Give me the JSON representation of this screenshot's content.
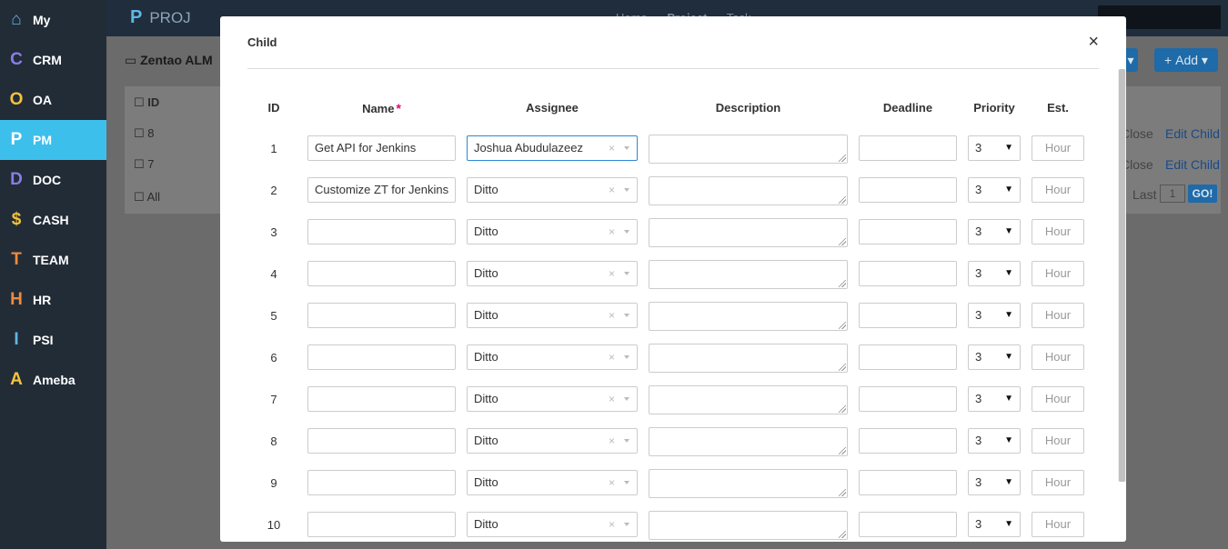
{
  "nav": {
    "items": [
      {
        "glyph": "⌂",
        "label": "My",
        "color": "#5fb7e4"
      },
      {
        "glyph": "C",
        "label": "CRM",
        "color": "#8c7ce6"
      },
      {
        "glyph": "O",
        "label": "OA",
        "color": "#f5c33b"
      },
      {
        "glyph": "P",
        "label": "PM",
        "color": "#ffffff"
      },
      {
        "glyph": "D",
        "label": "DOC",
        "color": "#8c7ce6"
      },
      {
        "glyph": "$",
        "label": "CASH",
        "color": "#f5c33b"
      },
      {
        "glyph": "T",
        "label": "TEAM",
        "color": "#f08a3e"
      },
      {
        "glyph": "H",
        "label": "HR",
        "color": "#f08a3e"
      },
      {
        "glyph": "I",
        "label": "PSI",
        "color": "#5fb7e4"
      },
      {
        "glyph": "A",
        "label": "Ameba",
        "color": "#f5c33b"
      }
    ],
    "collapse_glyph": "‹"
  },
  "topbar": {
    "brand_glyph": "P",
    "brand_text": "PROJ",
    "menu": [
      "Home",
      "Project",
      "Task"
    ]
  },
  "page": {
    "breadcrumb": "Zentao ALM",
    "add_button": "Add",
    "table": {
      "id_header": "ID",
      "rows": [
        {
          "id": "8",
          "close": "Close",
          "edit_child": "Edit Child"
        },
        {
          "id": "7",
          "close": "Close",
          "edit_child": "Edit Child"
        }
      ],
      "all_label": "All",
      "last_label": "Last",
      "page_value": "1",
      "go_label": "GO!"
    }
  },
  "modal": {
    "title": "Child",
    "close_glyph": "×",
    "headers": {
      "id": "ID",
      "name": "Name",
      "required_mark": "*",
      "assignee": "Assignee",
      "description": "Description",
      "deadline": "Deadline",
      "priority": "Priority",
      "est": "Est."
    },
    "est_placeholder": "Hour",
    "clear_glyph": "×",
    "rows": [
      {
        "id": "1",
        "name": "Get API for Jenkins",
        "assignee": "Joshua Abudulazeez",
        "priority": "3"
      },
      {
        "id": "2",
        "name": "Customize ZT for Jenkins",
        "assignee": "Ditto",
        "priority": "3"
      },
      {
        "id": "3",
        "name": "",
        "assignee": "Ditto",
        "priority": "3"
      },
      {
        "id": "4",
        "name": "",
        "assignee": "Ditto",
        "priority": "3"
      },
      {
        "id": "5",
        "name": "",
        "assignee": "Ditto",
        "priority": "3"
      },
      {
        "id": "6",
        "name": "",
        "assignee": "Ditto",
        "priority": "3"
      },
      {
        "id": "7",
        "name": "",
        "assignee": "Ditto",
        "priority": "3"
      },
      {
        "id": "8",
        "name": "",
        "assignee": "Ditto",
        "priority": "3"
      },
      {
        "id": "9",
        "name": "",
        "assignee": "Ditto",
        "priority": "3"
      },
      {
        "id": "10",
        "name": "",
        "assignee": "Ditto",
        "priority": "3"
      }
    ]
  }
}
